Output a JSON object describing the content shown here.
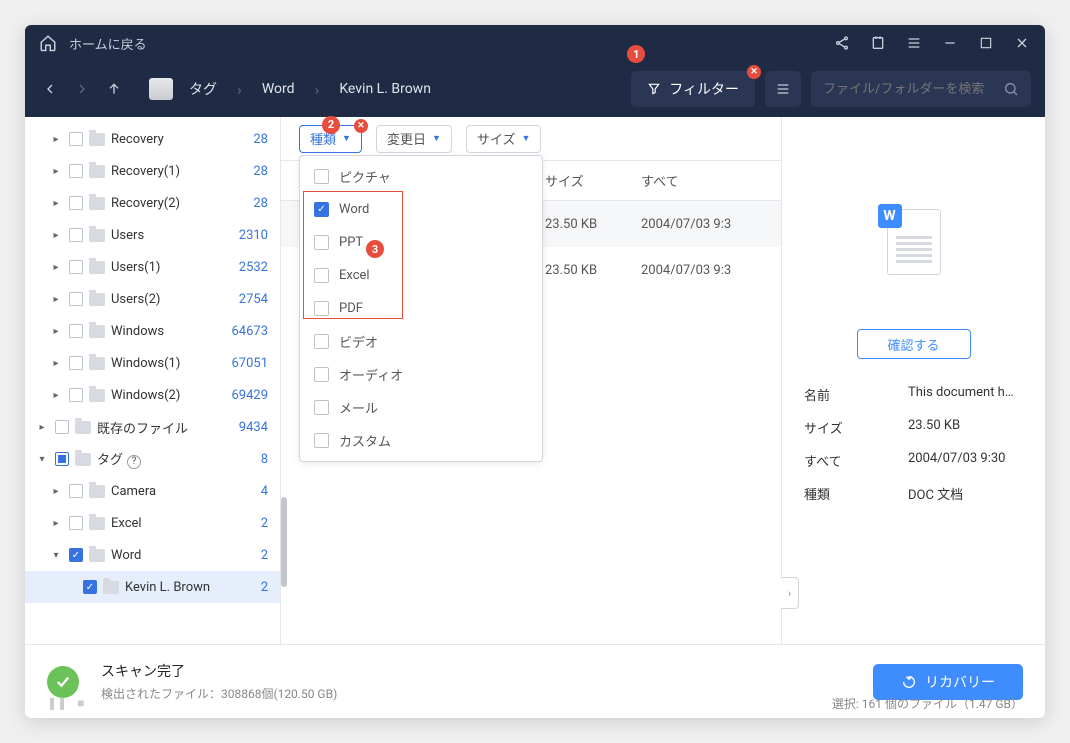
{
  "titlebar": {
    "home": "ホームに戻る"
  },
  "breadcrumb": {
    "tag": "タグ",
    "word": "Word",
    "person": "Kevin L. Brown"
  },
  "toolbar": {
    "filter": "フィルター",
    "search_placeholder": "ファイル/フォルダーを検索"
  },
  "annotations": {
    "n1": "1",
    "n2": "2",
    "n3": "3"
  },
  "sidebar": {
    "items": [
      {
        "label": "Recovery",
        "count": "28"
      },
      {
        "label": "Recovery(1)",
        "count": "28"
      },
      {
        "label": "Recovery(2)",
        "count": "28"
      },
      {
        "label": "Users",
        "count": "2310"
      },
      {
        "label": "Users(1)",
        "count": "2532"
      },
      {
        "label": "Users(2)",
        "count": "2754"
      },
      {
        "label": "Windows",
        "count": "64673"
      },
      {
        "label": "Windows(1)",
        "count": "67051"
      },
      {
        "label": "Windows(2)",
        "count": "69429"
      },
      {
        "label": "既存のファイル",
        "count": "9434"
      }
    ],
    "tag": {
      "label": "タグ",
      "count": "8"
    },
    "tag_children": [
      {
        "label": "Camera",
        "count": "4"
      },
      {
        "label": "Excel",
        "count": "2"
      },
      {
        "label": "Word",
        "count": "2"
      },
      {
        "label": "Kevin L. Brown",
        "count": "2"
      }
    ]
  },
  "main_filters": {
    "type": "種類",
    "date": "変更日",
    "size": "サイズ"
  },
  "type_dropdown": {
    "picture": "ピクチャ",
    "word": "Word",
    "ppt": "PPT",
    "excel": "Excel",
    "pdf": "PDF",
    "video": "ビデオ",
    "audio": "オーディオ",
    "mail": "メール",
    "custom": "カスタム"
  },
  "table": {
    "headers": {
      "size": "サイズ",
      "date": "すべて"
    },
    "rows": [
      {
        "size": "23.50 KB",
        "date": "2004/07/03 9:3"
      },
      {
        "size": "23.50 KB",
        "date": "2004/07/03 9:3"
      }
    ]
  },
  "details": {
    "confirm": "確認する",
    "rows": {
      "name_k": "名前",
      "name_v": "This document h…",
      "size_k": "サイズ",
      "size_v": "23.50 KB",
      "date_k": "すべて",
      "date_v": "2004/07/03 9:30",
      "type_k": "種類",
      "type_v": "DOC 文档"
    }
  },
  "footer": {
    "scan_done": "スキャン完了",
    "detected": "検出されたファイル：308868個(120.50 GB)",
    "recover": "リカバリー",
    "selection": "選択: 161 個のファイル（1.47 GB）"
  }
}
